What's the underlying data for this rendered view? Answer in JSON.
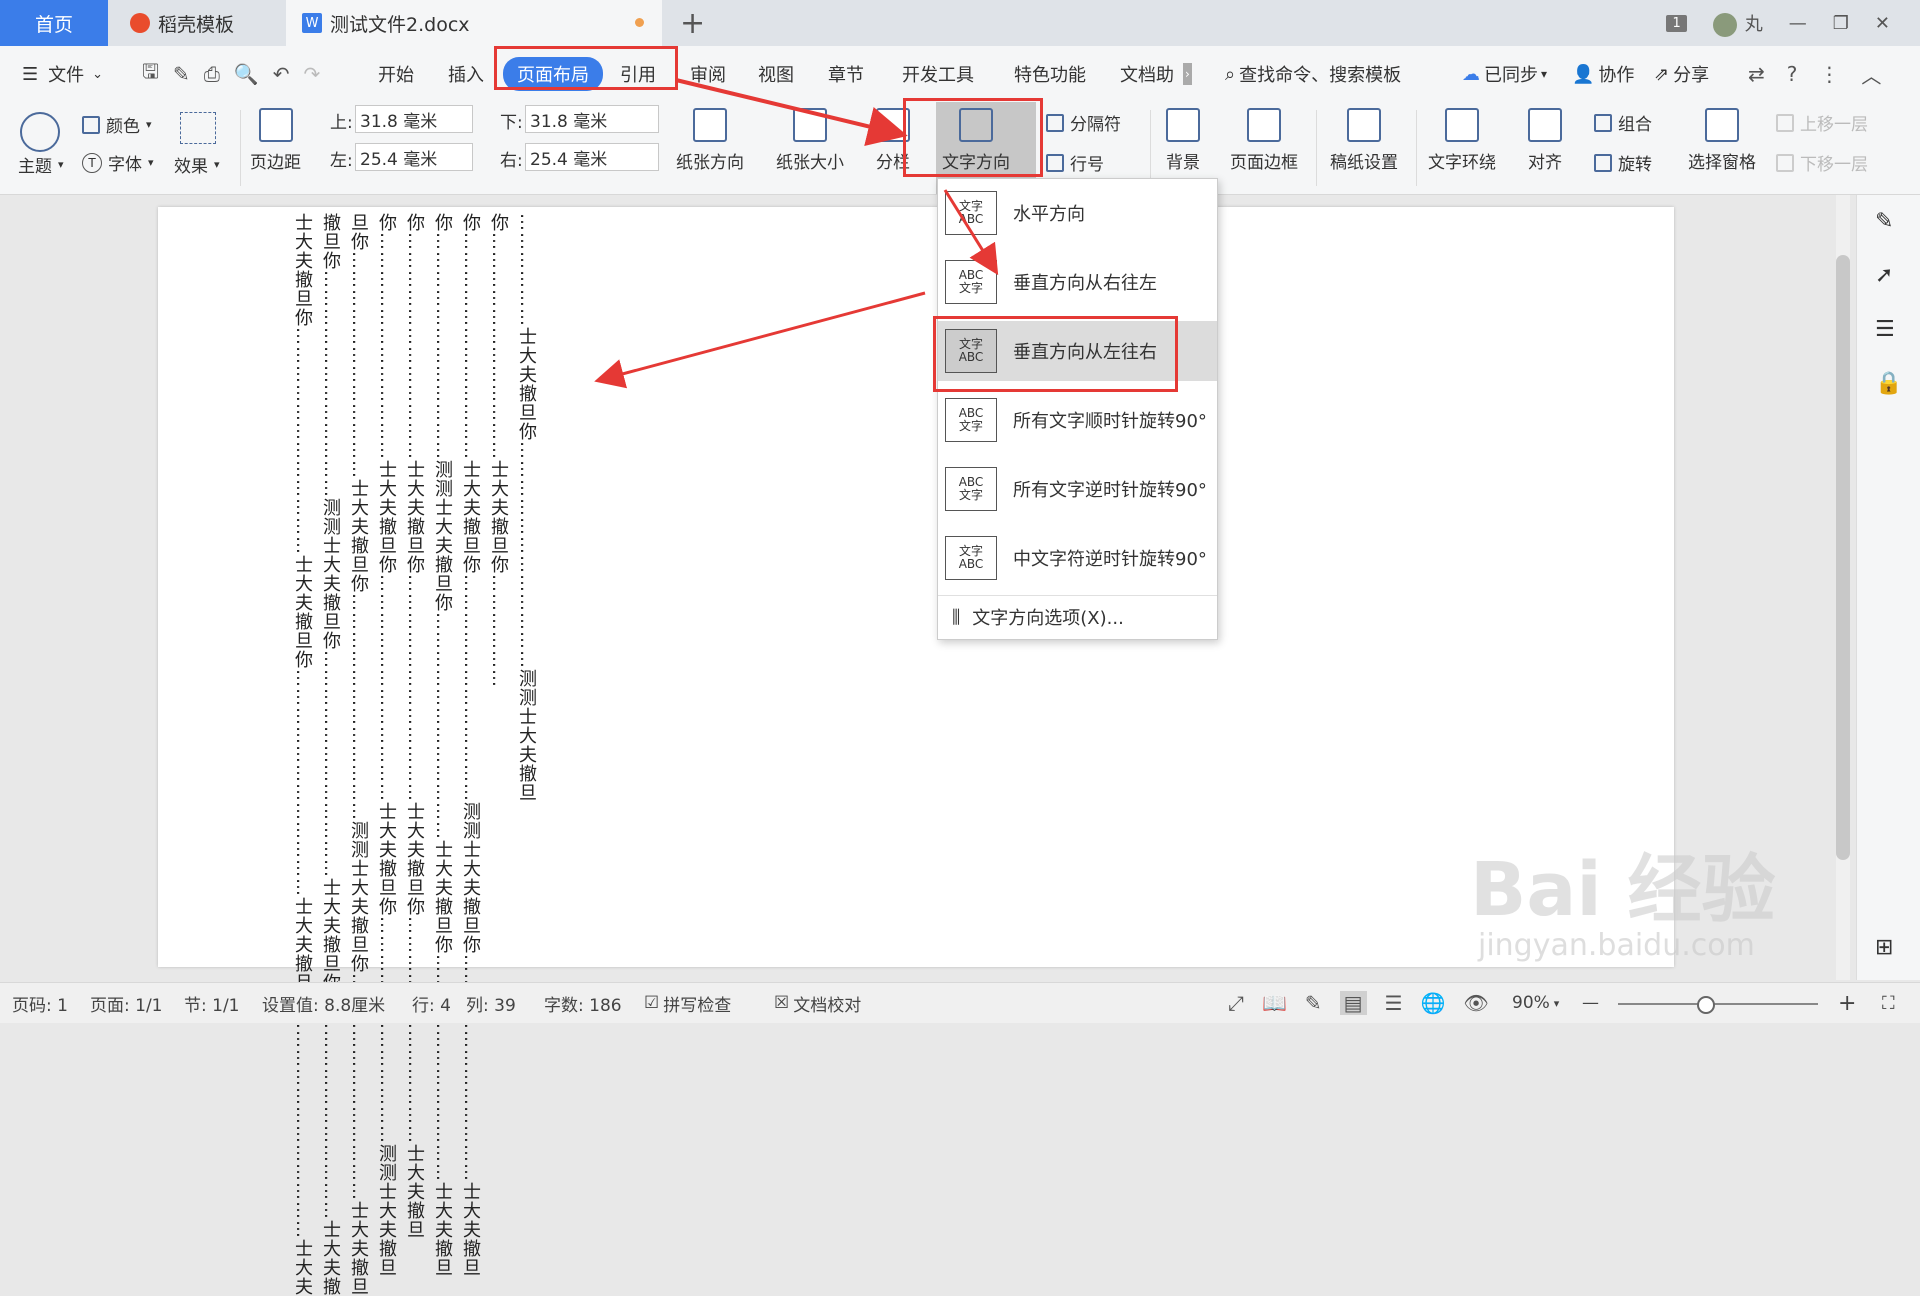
{
  "tabs": {
    "home": "首页",
    "daoke": "稻壳模板",
    "doc": "测试文件2.docx",
    "new_tab": "+"
  },
  "window": {
    "badge": "1",
    "user": "丸",
    "min": "—",
    "restore": "❐",
    "close": "✕"
  },
  "menu": {
    "file": "文件",
    "start": "开始",
    "insert": "插入",
    "page_layout": "页面布局",
    "reference": "引用",
    "review": "审阅",
    "view": "视图",
    "chapter": "章节",
    "devtools": "开发工具",
    "special": "特色功能",
    "dochelper": "文档助",
    "search": "查找命令、搜索模板",
    "synced": "已同步",
    "collab": "协作",
    "share": "分享"
  },
  "ribbon": {
    "theme": "主题",
    "color": "颜色",
    "font": "字体",
    "effect": "效果",
    "margins": "页边距",
    "top_label": "上:",
    "top_value": "31.8 毫米",
    "bottom_label": "下:",
    "bottom_value": "31.8 毫米",
    "left_label": "左:",
    "left_value": "25.4 毫米",
    "right_label": "右:",
    "right_value": "25.4 毫米",
    "orientation": "纸张方向",
    "size": "纸张大小",
    "columns": "分栏",
    "text_direction": "文字方向",
    "separator": "分隔符",
    "line_number": "行号",
    "background": "背景",
    "page_border": "页面边框",
    "draft_paper": "稿纸设置",
    "text_wrap": "文字环绕",
    "align": "对齐",
    "group": "组合",
    "rotate": "旋转",
    "selection_pane": "选择窗格",
    "bring_forward": "上移一层",
    "send_backward": "下移一层"
  },
  "dropdown": {
    "items": [
      {
        "label": "水平方向",
        "icon": "文字\nABC"
      },
      {
        "label": "垂直方向从右往左",
        "icon": "ABC\n文字"
      },
      {
        "label": "垂直方向从左往右",
        "icon": "文字\nABC"
      },
      {
        "label": "所有文字顺时针旋转90°",
        "icon": "ABC\n文字"
      },
      {
        "label": "所有文字逆时针旋转90°",
        "icon": "ABC\n文字"
      },
      {
        "label": "中文字符逆时针旋转90°",
        "icon": "文字\nABC"
      }
    ],
    "options": "文字方向选项(X)..."
  },
  "document": {
    "columns": [
      "士大夫撤旦你………………………………士大夫撤旦你………………………………士大夫撤旦你………………………………士大夫",
      "撤旦你………………………………测测士大夫撤旦你………………………………士大夫撤旦你………………………………士大夫撤",
      "旦你………………………………士大夫撤旦你………………………………测测士大夫撤旦你………………………………士大夫撤旦",
      "你………………………………士大夫撤旦你………………………………士大夫撤旦你………………………………测测士大夫撤旦",
      "你………………………………士大夫撤旦你………………………………士大夫撤旦你………………………………士大夫撤旦",
      "你………………………………测测士大夫撤旦你………………………………士大夫撤旦你………………………………士大夫撤旦",
      "你………………………………士大夫撤旦你………………………………测测士大夫撤旦你………………………………士大夫撤旦",
      "你………………………………士大夫撤旦你………………",
      "………………士大夫撤旦你………………………………测测士大夫撤旦"
    ]
  },
  "status": {
    "page_code": "页码: 1",
    "page": "页面: 1/1",
    "section": "节: 1/1",
    "setting": "设置值: 8.8厘米",
    "row": "行: 4",
    "col": "列: 39",
    "words": "字数: 186",
    "spell": "拼写检查",
    "proof": "文档校对",
    "zoom": "90%",
    "minus": "—",
    "plus": "+"
  },
  "watermark": {
    "main": "Bai 经验",
    "url": "jingyan.baidu.com"
  },
  "colors": {
    "accent": "#3b7de9",
    "annotation": "#e53935"
  }
}
